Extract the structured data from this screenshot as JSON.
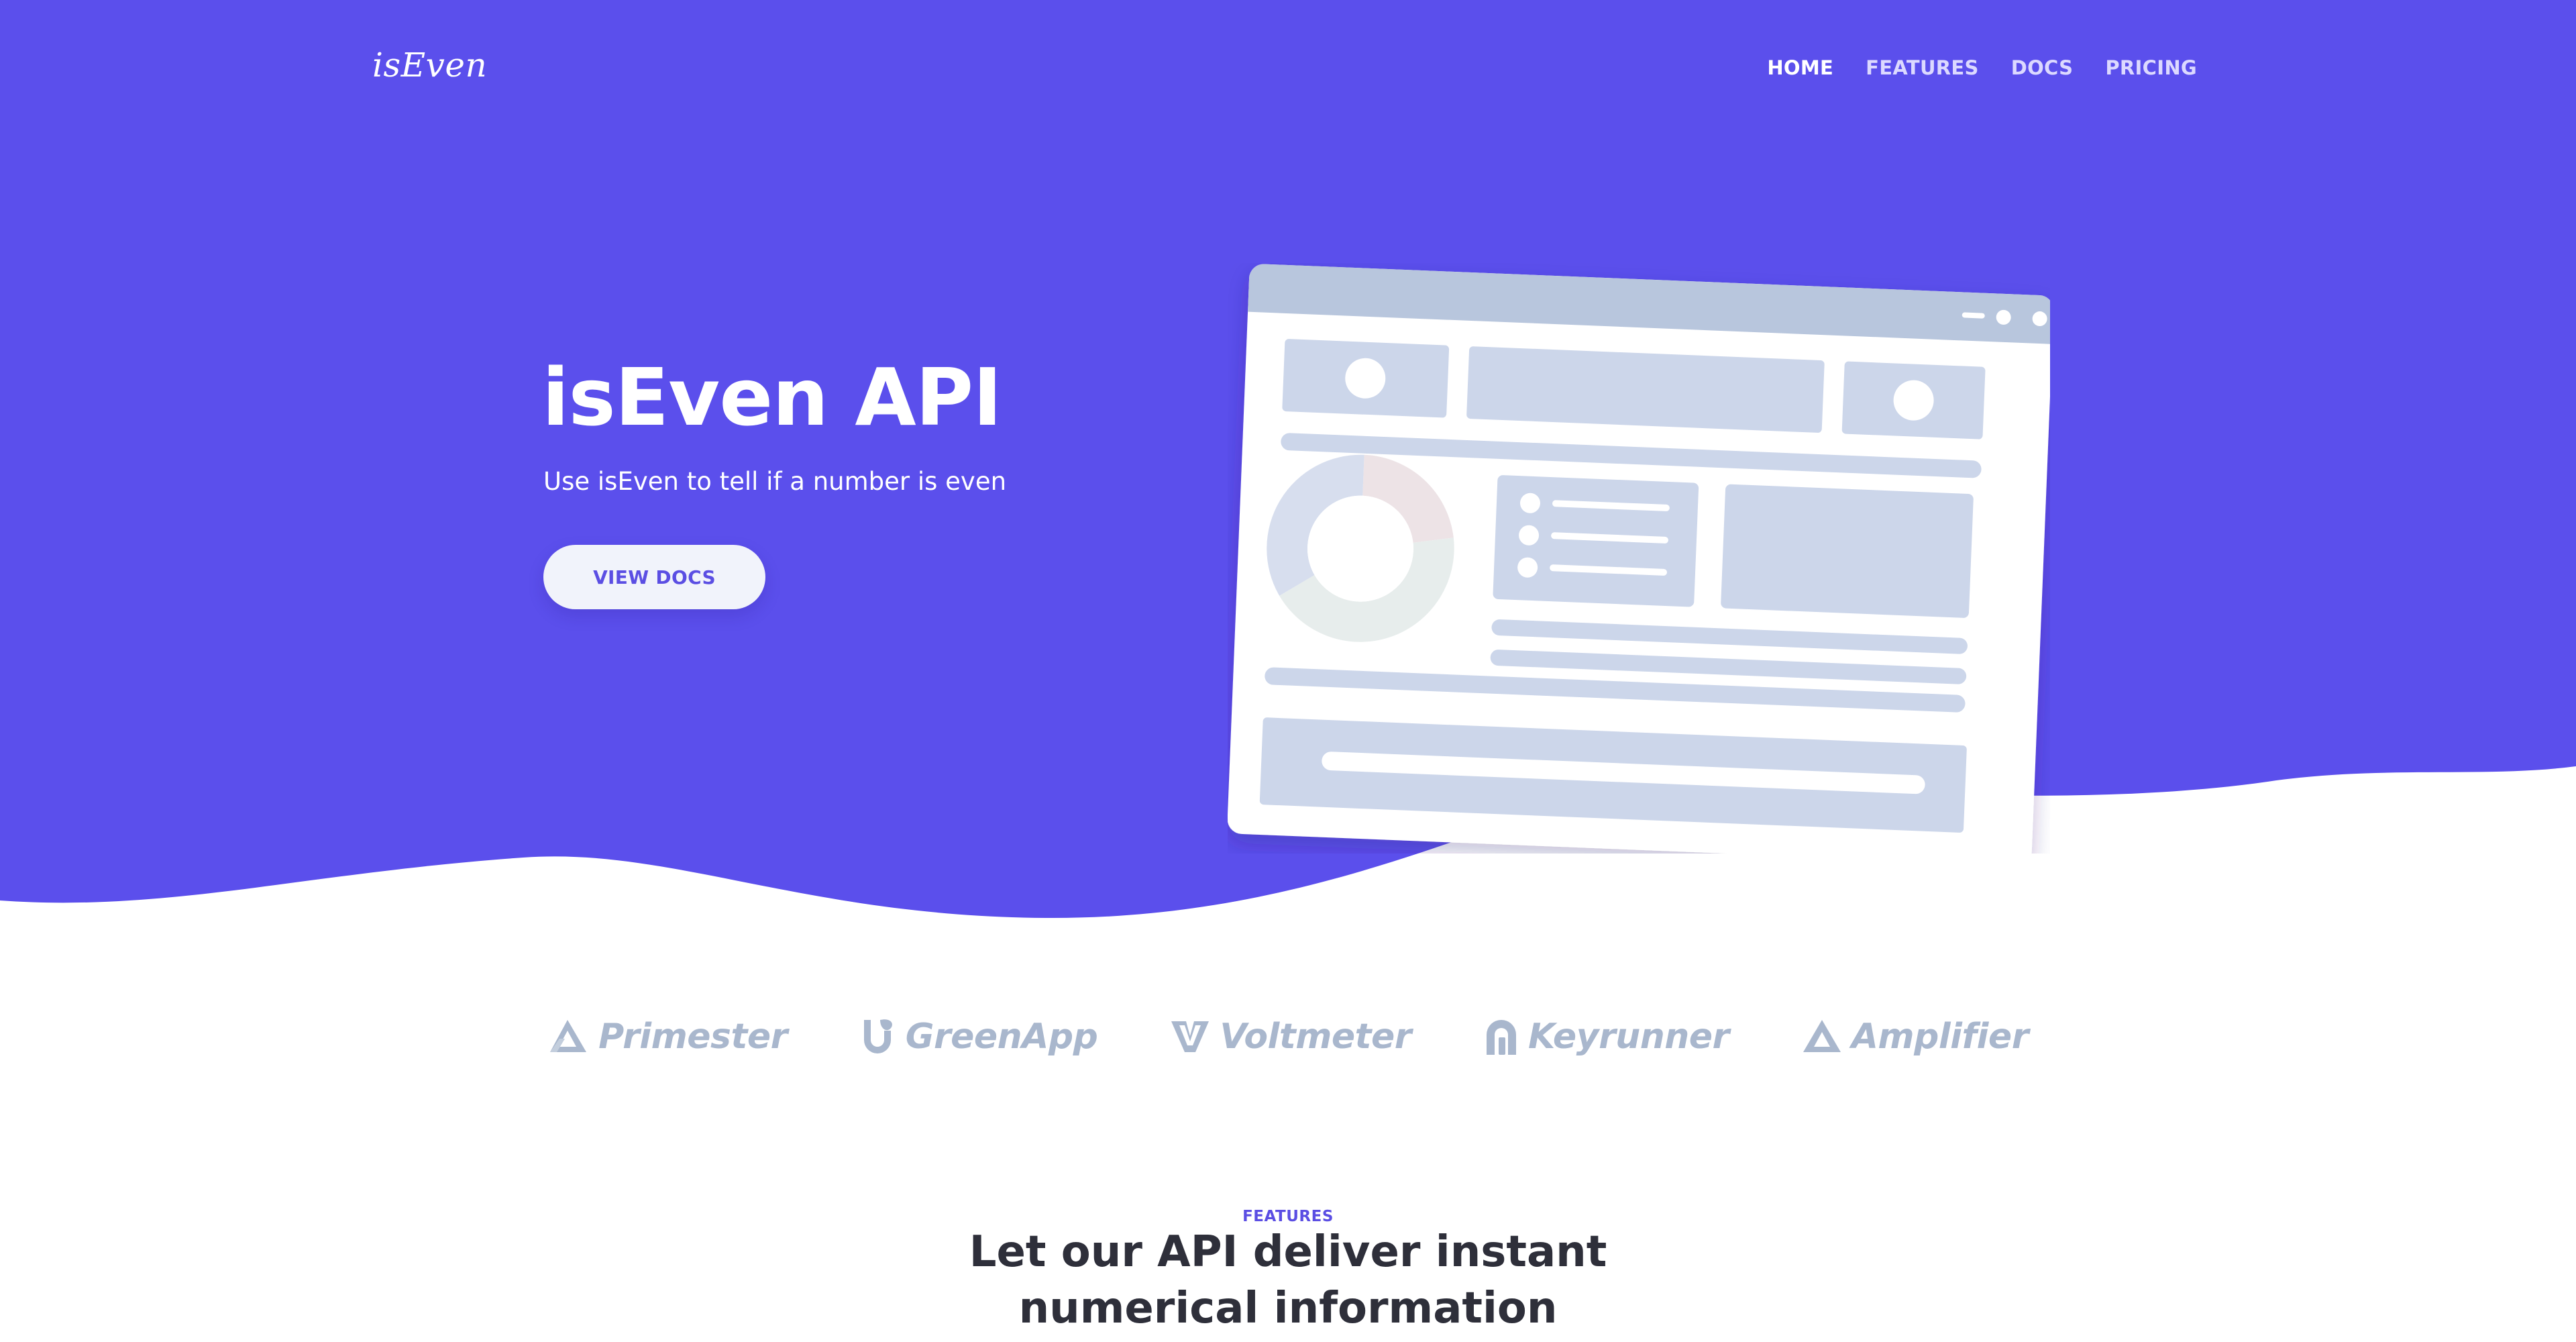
{
  "colors": {
    "brand": "#5B4FEC",
    "white": "#FFFFFF",
    "mock_gray": "#CCD6EA",
    "logo_gray": "#A9B7CD",
    "heading_dark": "#2E2F3A"
  },
  "header": {
    "logo": "isEven",
    "nav": [
      {
        "label": "HOME",
        "active": true
      },
      {
        "label": "FEATURES",
        "active": false
      },
      {
        "label": "DOCS",
        "active": false
      },
      {
        "label": "PRICING",
        "active": false
      }
    ]
  },
  "hero": {
    "title": "isEven API",
    "subtitle": "Use isEven to tell if a number is even",
    "cta_label": "VIEW DOCS"
  },
  "clients": [
    {
      "name": "Primester",
      "icon": "primester-logo-icon"
    },
    {
      "name": "GreenApp",
      "icon": "greenapp-logo-icon"
    },
    {
      "name": "Voltmeter",
      "icon": "voltmeter-logo-icon"
    },
    {
      "name": "Keyrunner",
      "icon": "keyrunner-logo-icon"
    },
    {
      "name": "Amplifier",
      "icon": "amplifier-logo-icon"
    }
  ],
  "features": {
    "label": "FEATURES",
    "title_line1": "Let our API deliver instant",
    "title_line2": "numerical information"
  }
}
